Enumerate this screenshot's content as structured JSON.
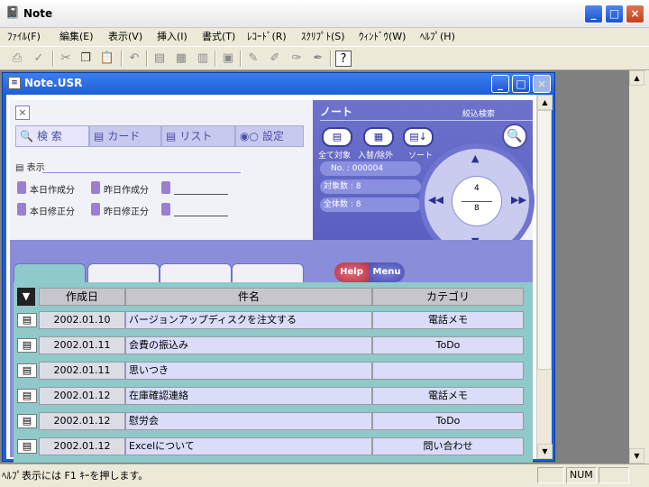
{
  "app": {
    "title": "Note",
    "icon": "notebook-icon"
  },
  "window_controls": {
    "minimize": "_",
    "maximize": "□",
    "close": "×"
  },
  "menu": [
    "ﾌｧｲﾙ(F)",
    "編集(E)",
    "表示(V)",
    "挿入(I)",
    "書式(T)",
    "ﾚｺｰﾄﾞ(R)",
    "ｽｸﾘﾌﾟﾄ(S)",
    "ｳｨﾝﾄﾞｳ(W)",
    "ﾍﾙﾌﾟ(H)"
  ],
  "toolbar_icons": [
    "print-icon",
    "spellcheck-icon",
    "cut-icon",
    "copy-icon",
    "paste-icon",
    "undo-icon",
    "form-icon",
    "form2-icon",
    "form3-icon",
    "layout-icon",
    "tool-icon",
    "tool2-icon",
    "tool3-icon",
    "help-icon"
  ],
  "child": {
    "title": "Note.USR"
  },
  "nav": {
    "search": "検 索",
    "card": "カード",
    "list": "リスト",
    "settings": "設定"
  },
  "filters": {
    "section": "表示",
    "today_created": "本日作成分",
    "yesterday_created": "昨日作成分",
    "today_modified": "本日修正分",
    "yesterday_modified": "昨日修正分"
  },
  "note_panel": {
    "title": "ノート",
    "btn_all": "全て対象",
    "btn_swap": "入替/除外",
    "btn_sort": "ソート",
    "narrow_search": "絞込検索",
    "no_label": "No. :",
    "no_value": "000004",
    "target_label": "対象数 :",
    "target_value": "8",
    "total_label": "全体数 :",
    "total_value": "8",
    "dial_top": "4",
    "dial_bottom": "8"
  },
  "help": "Help",
  "menu_btn": "Menu",
  "table": {
    "headers": [
      "作成日",
      "件名",
      "カテゴリ"
    ],
    "rows": [
      {
        "date": "2002.01.10",
        "name": "バージョンアップディスクを注文する",
        "cat": "電話メモ"
      },
      {
        "date": "2002.01.11",
        "name": "会費の振込み",
        "cat": "ToDo"
      },
      {
        "date": "2002.01.11",
        "name": "思いつき",
        "cat": ""
      },
      {
        "date": "2002.01.12",
        "name": "在庫確認連絡",
        "cat": "電話メモ"
      },
      {
        "date": "2002.01.12",
        "name": "慰労会",
        "cat": "ToDo"
      },
      {
        "date": "2002.01.12",
        "name": "Excelについて",
        "cat": "問い合わせ"
      }
    ]
  },
  "status": {
    "text": "ﾍﾙﾌﾟ表示には F1 ｷｰを押します。",
    "num": "NUM"
  }
}
